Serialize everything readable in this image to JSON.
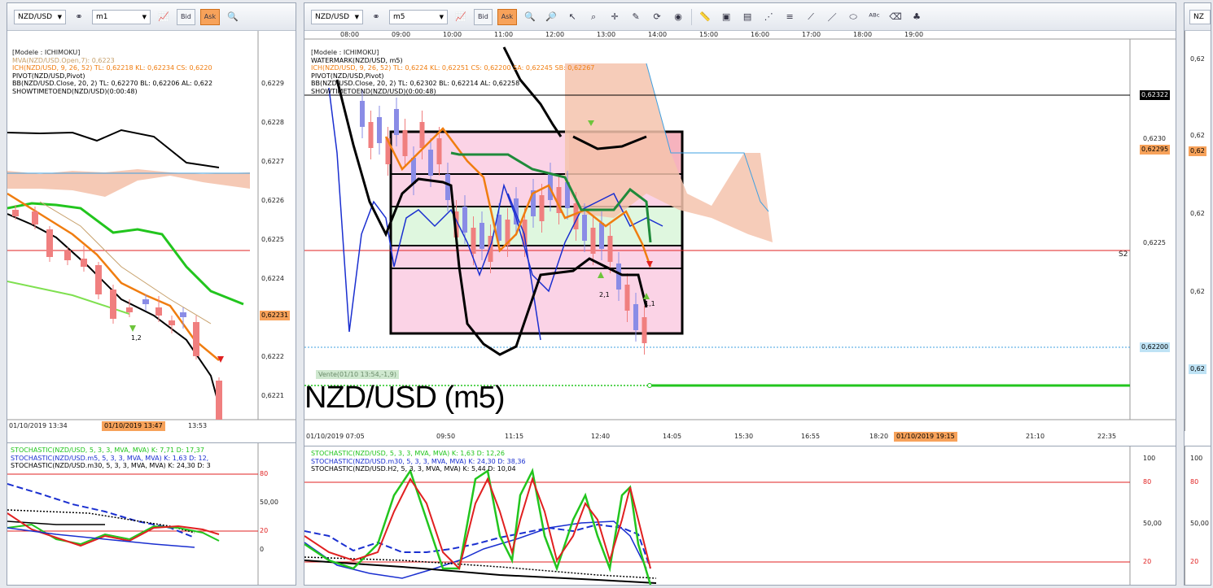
{
  "left": {
    "symbol": "NZD/USD",
    "timeframe": "m1",
    "legend": [
      "[Modele : ICHIMOKU]",
      "MVA(NZD/USD.Open,7): 0,6223",
      "ICH(NZD/USD, 9, 26, 52)   TL: 0,62218   KL: 0,62234   CS: 0,6220",
      "PIVOT(NZD/USD,Pivot)",
      "BB(NZD/USD.Close, 20, 2)   TL: 0,62270   BL: 0,62206   AL: 0,622",
      "SHOWTIMETOEND(NZD/USD)(0:00:48)"
    ],
    "price_ticks": [
      "0,6229",
      "0,6228",
      "0,6227",
      "0,6226",
      "0,6225",
      "0,6224",
      "0,6223",
      "0,6222",
      "0,6221"
    ],
    "current_price": "0,62231",
    "marker_label": "1,2",
    "time_ticks": [
      "01/10/2019 13:34",
      "13:47",
      "13:53"
    ],
    "time_box": "01/10/2019 13:47",
    "stoch_legend": [
      "STOCHASTIC(NZD/USD, 5, 3, 3, MVA, MVA)   K: 7,71   D: 17,37",
      "STOCHASTIC(NZD/USD.m5, 5, 3, 3, MVA, MVA)   K: 1,63   D: 12,",
      "STOCHASTIC(NZD/USD.m30, 5, 3, 3, MVA, MVA)   K: 24,30   D: 3"
    ],
    "stoch_ticks": [
      "80",
      "50,00",
      "20",
      "0"
    ]
  },
  "main": {
    "symbol": "NZD/USD",
    "timeframe": "m5",
    "legend": [
      "[Modele : ICHIMOKU]",
      "WATERMARK(NZD/USD, m5)",
      "ICH(NZD/USD, 9, 26, 52)   TL: 0,6224   KL: 0,62251   CS: 0,62200   SA: 0,62245   SB: 0,62267",
      "PIVOT(NZD/USD,Pivot)",
      "BB(NZD/USD.Close, 20, 2)   TL: 0,62302   BL: 0,62214   AL: 0,62258",
      "SHOWTIMETOEND(NZD/USD)(0:00:48)"
    ],
    "top_time_ticks": [
      "08:00",
      "09:00",
      "10:00",
      "11:00",
      "12:00",
      "13:00",
      "14:00",
      "15:00",
      "16:00",
      "17:00",
      "18:00",
      "19:00"
    ],
    "bottom_time_ticks": [
      "01/10/2019 07:05",
      "09:50",
      "11:15",
      "12:40",
      "14:05",
      "15:30",
      "16:55",
      "18:20",
      "21:10",
      "22:35"
    ],
    "time_box": "01/10/2019 19:15",
    "price_ticks": [
      "0,6230",
      "0,6225"
    ],
    "boxes": [
      "0,62322",
      "0,62295",
      "0,62200"
    ],
    "s2_label": "S2",
    "markers": [
      "2,1",
      "1,1"
    ],
    "vente_label": "Vente(01/10 13:54,-1,9)",
    "watermark": "NZD/USD (m5)",
    "stoch_legend": [
      "STOCHASTIC(NZD/USD, 5, 3, 3, MVA, MVA)   K: 1,63   D: 12,26",
      "STOCHASTIC(NZD/USD.m30, 5, 3, 3, MVA, MVA)   K: 24,30   D: 38,36",
      "STOCHASTIC(NZD/USD.H2, 5, 3, 3, MVA, MVA)   K: 5,44   D: 10,04"
    ],
    "stoch_ticks": [
      "100",
      "80",
      "50,00",
      "20"
    ]
  },
  "right": {
    "symbol": "NZ",
    "price_ticks": [
      "0,62",
      "0,62",
      "0,62",
      "0,62"
    ],
    "boxes": [
      "0,62",
      "0,62"
    ],
    "stoch_ticks": [
      "100",
      "80",
      "50,00",
      "20"
    ]
  },
  "toolbar": {
    "bid_label": "Bid",
    "ask_label": "Ask"
  },
  "colors": {
    "green": "#22c51e",
    "orange": "#f07d10",
    "blue": "#1a2fd0",
    "red": "#e02020",
    "cloud": "#f4c3ad",
    "bullish": "#8a8ce6",
    "bearish": "#f07f7f"
  }
}
